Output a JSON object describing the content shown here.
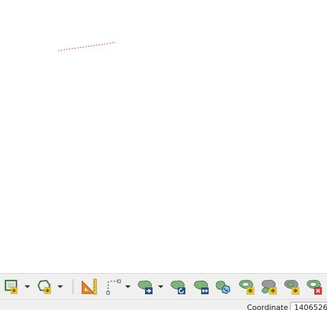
{
  "map": {
    "feature_color": "#e0443c"
  },
  "colors": {
    "polygon_fill": "#7fb27f",
    "polygon_stroke": "#3f7a3f",
    "gray_fill": "#9a9a9a",
    "star_yellow": "#f2d23c",
    "ruler_orange": "#e8862a",
    "delete_red": "#d23a3a",
    "arrow_blue": "#2b4f7a",
    "toolbar_bg": "#f0f0f0"
  },
  "toolbar": {
    "tools": [
      {
        "name": "add-ring-tool",
        "icon": "add-ring-icon",
        "has_dropdown": true
      },
      {
        "name": "add-part-tool",
        "icon": "add-part-icon",
        "has_dropdown": true
      },
      {
        "name": "measure-angle-tool",
        "icon": "set-square-ruler-icon",
        "has_dropdown": false
      },
      {
        "name": "select-rectangle-tool",
        "icon": "dashed-selection-icon",
        "has_dropdown": true
      },
      {
        "name": "move-feature-tool",
        "icon": "move-feature-icon",
        "has_dropdown": true
      },
      {
        "name": "rotate-feature-tool",
        "icon": "rotate-feature-icon",
        "has_dropdown": false
      },
      {
        "name": "offset-curve-tool",
        "icon": "offset-curve-icon",
        "has_dropdown": false
      },
      {
        "name": "simplify-feature-tool",
        "icon": "simplify-feature-icon",
        "has_dropdown": false
      },
      {
        "name": "add-ring-feature-tool",
        "icon": "ring-star-icon",
        "has_dropdown": false
      },
      {
        "name": "split-features-tool",
        "icon": "split-features-icon",
        "has_dropdown": false
      },
      {
        "name": "fill-ring-tool",
        "icon": "fill-ring-icon",
        "has_dropdown": false
      },
      {
        "name": "delete-ring-tool",
        "icon": "delete-ring-icon",
        "has_dropdown": false
      }
    ]
  },
  "statusbar": {
    "coordinate_label": "Coordinate",
    "coordinate_value": "1406526"
  }
}
